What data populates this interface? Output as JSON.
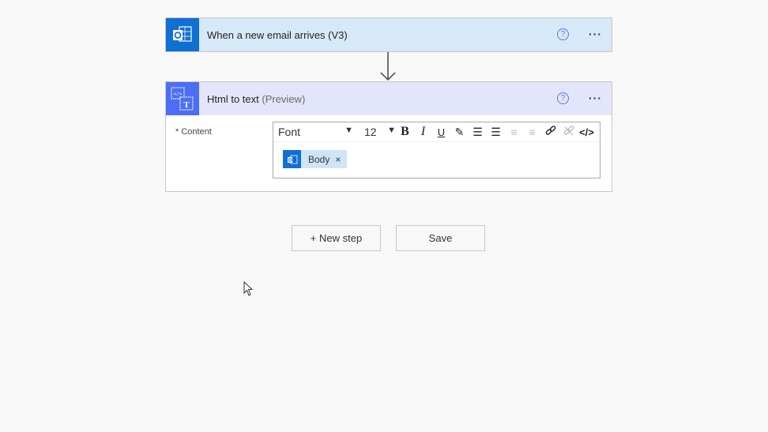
{
  "trigger": {
    "title": "When a new email arrives (V3)",
    "icon": "outlook-icon",
    "help_icon": "help-icon",
    "more_icon": "more-options-icon",
    "help_glyph": "?",
    "more_glyph": "···"
  },
  "action": {
    "title": "Html to text",
    "preview_tag": "(Preview)",
    "icon": "html-to-text-icon",
    "help_glyph": "?",
    "more_glyph": "···",
    "content_label": "* Content",
    "toolbar": {
      "font_value": "Font",
      "size_value": "12",
      "dropdown_glyph": "▼",
      "bold": "B",
      "italic": "I",
      "underline": "U",
      "highlight": "✎",
      "bullet_list": "☰",
      "numbered_list": "☰",
      "decrease_indent": "≡",
      "increase_indent": "≡",
      "link": "🔗",
      "unlink": "⛓",
      "code_view": "</>"
    },
    "token": {
      "label": "Body",
      "close_glyph": "×"
    }
  },
  "buttons": {
    "new_step": "+ New step",
    "save": "Save"
  },
  "colors": {
    "outlook_blue": "#0f6fd3",
    "action_blue": "#4b6ef3",
    "trigger_header": "#d7e8f8",
    "action_header": "#e3e6fb"
  }
}
